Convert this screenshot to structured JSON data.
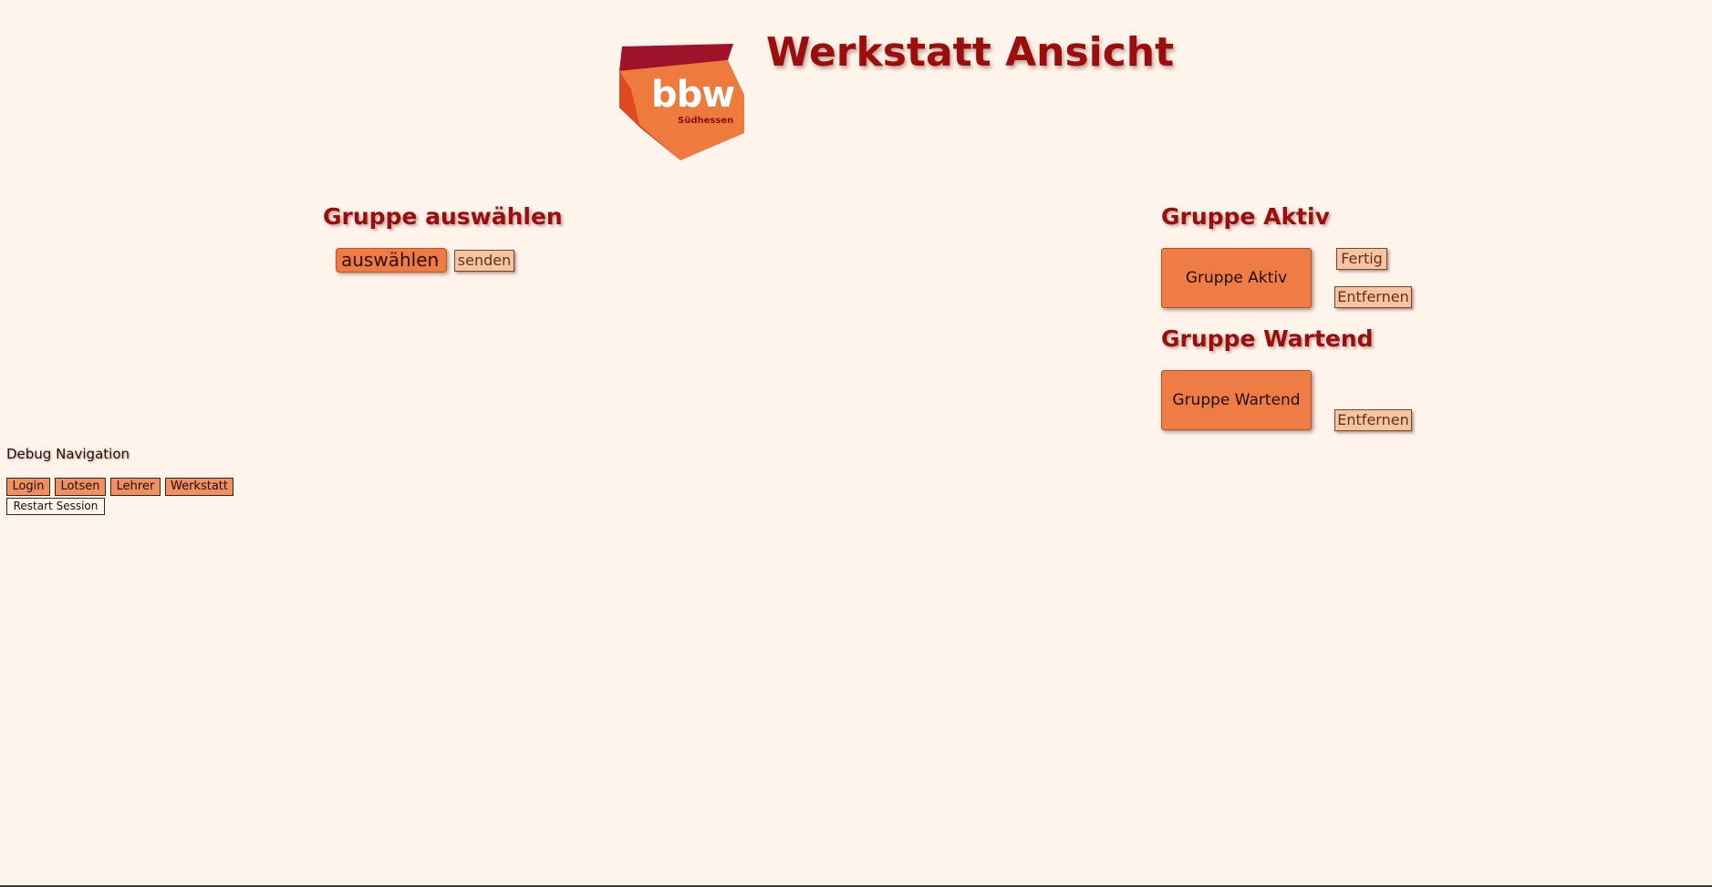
{
  "header": {
    "title": "Werkstatt Ansicht",
    "logo_text": "bbw",
    "logo_subtext": "Südhessen"
  },
  "select_group": {
    "heading": "Gruppe auswählen",
    "dropdown_value": "auswählen",
    "submit_label": "senden"
  },
  "active_group": {
    "heading": "Gruppe Aktiv",
    "group_label": "Gruppe Aktiv",
    "done_label": "Fertig",
    "remove_label": "Entfernen"
  },
  "waiting_group": {
    "heading": "Gruppe Wartend",
    "group_label": "Gruppe Wartend",
    "remove_label": "Entfernen"
  },
  "debug": {
    "label": "Debug Navigation",
    "nav": [
      "Login",
      "Lotsen",
      "Lehrer",
      "Werkstatt"
    ],
    "restart_label": "Restart Session"
  },
  "colors": {
    "background": "#fef4ec",
    "heading": "#9a0e0e",
    "accent": "#f07c45",
    "button_light": "#f7c3a1"
  }
}
